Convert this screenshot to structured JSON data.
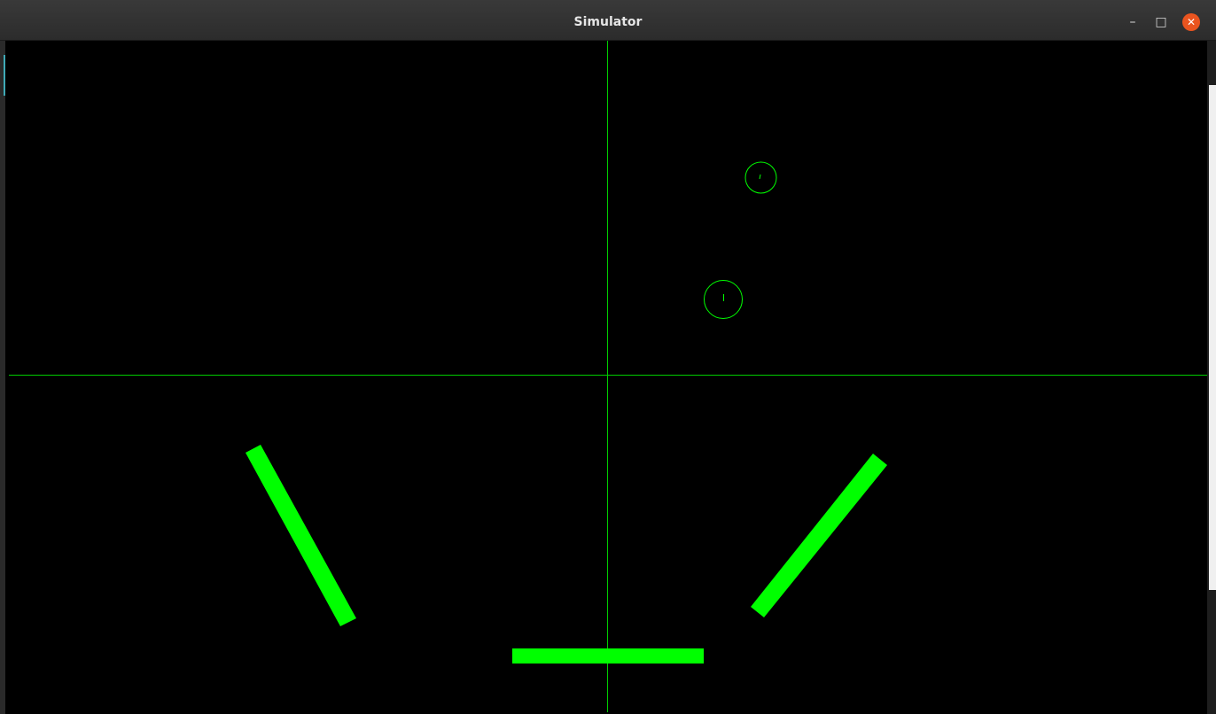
{
  "window": {
    "title": "Simulator",
    "controls": {
      "minimize": "–",
      "maximize": "□",
      "close": "✕"
    }
  },
  "colors": {
    "background": "#000000",
    "primary": "#00ff00",
    "axis": "#00cc00",
    "close_button": "#e9541f"
  },
  "scene": {
    "axes": [
      "horizontal-axis",
      "vertical-axis"
    ],
    "balls": [
      {
        "name": "ball-1",
        "label": "ball"
      },
      {
        "name": "ball-2",
        "label": "ball"
      }
    ],
    "paddles": [
      "left-paddle",
      "bottom-paddle",
      "right-paddle"
    ]
  }
}
